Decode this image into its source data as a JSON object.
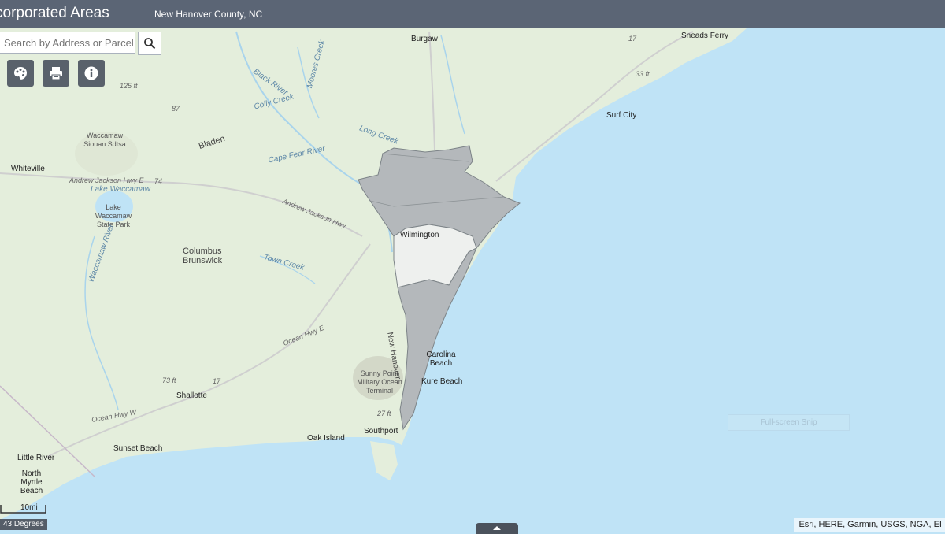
{
  "header": {
    "title": "corporated Areas",
    "subtitle": "New Hanover County, NC"
  },
  "search": {
    "placeholder": "Search by Address or Parcel"
  },
  "toolbar": [
    {
      "icon": "basemap-gallery-icon"
    },
    {
      "icon": "print-icon"
    },
    {
      "icon": "info-icon"
    }
  ],
  "map": {
    "place_labels": {
      "burgaw": "Burgaw",
      "sneads_ferry": "Sneads Ferry",
      "surf_city": "Surf City",
      "whiteville": "Whiteville",
      "wilmington": "Wilmington",
      "carolina_beach": "Carolina Beach",
      "kure_beach": "Kure Beach",
      "southport": "Southport",
      "oak_island": "Oak Island",
      "shallotte": "Shallotte",
      "sunset_beach": "Sunset Beach",
      "little_river": "Little River",
      "north_myrtle_beach": "North Myrtle Beach"
    },
    "area_labels": {
      "waccamaw_siouan": "Waccamaw Siouan Sdtsa",
      "lake_waccamaw_sp": "Lake Waccamaw State Park",
      "columbus": "Columbus",
      "brunswick": "Brunswick",
      "bladen": "Bladen",
      "new_hanover": "New Hanover",
      "sunny_point": "Sunny Point Military Ocean Terminal"
    },
    "water_labels": {
      "black_river": "Black River",
      "moores_creek": "Moores Creek",
      "colly_creek": "Colly Creek",
      "long_creek": "Long Creek",
      "cape_fear_river": "Cape Fear River",
      "lake_waccamaw": "Lake Waccamaw",
      "waccamaw_river": "Waccamaw River",
      "town_creek": "Town Creek"
    },
    "road_labels": {
      "ajh_1": "Andrew Jackson Hwy E",
      "ajh_2": "Andrew Jackson Hwy",
      "ocean_hwy_e": "Ocean Hwy E",
      "ocean_hwy_w": "Ocean Hwy W"
    },
    "elevation_labels": {
      "e125": "125 ft",
      "e87": "87",
      "e33": "33 ft",
      "e73": "73 ft",
      "e27": "27 ft",
      "r17a": "17",
      "r17b": "17",
      "r74": "74"
    },
    "scale_label": "10mi",
    "coordinates": "43 Degrees",
    "attribution": "Esri, HERE, Garmin, USGS, NGA, EI",
    "overlay_text": "Full-screen Snip",
    "colors": {
      "water": "#bfe3f6",
      "land": "#e4eedc",
      "incorporated": "#b4b8bb",
      "header": "#5b6575",
      "tool": "#59616b"
    }
  }
}
